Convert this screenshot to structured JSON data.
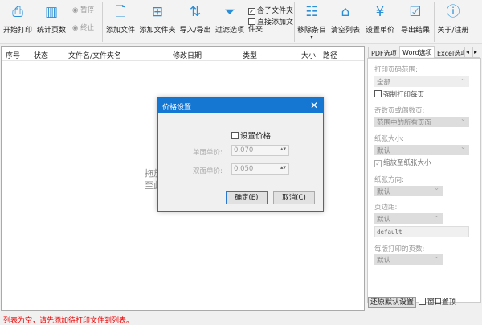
{
  "toolbar": {
    "start_print": "开始打印",
    "count_pages": "统计页数",
    "pause": "暂停",
    "stop": "终止",
    "add_file": "添加文件",
    "add_folder": "添加文件夹",
    "import_export": "导入/导出",
    "filter": "过滤选项",
    "include_subfolders": "含子文件夹",
    "direct_add_folder": "直接添加文件夹",
    "remove_items": "移除条目",
    "clear_list": "清空列表",
    "set_price": "设置单价",
    "export_results": "导出结果",
    "about": "关于/注册"
  },
  "list": {
    "columns": [
      "序号",
      "状态",
      "文件名/文件夹名",
      "修改日期",
      "类型",
      "大小",
      "路径"
    ],
    "drop_hint_1": "拖放",
    "drop_hint_2": "至此"
  },
  "panel": {
    "tabs": [
      "PDF选项",
      "Word选项",
      "Excel选项"
    ],
    "print_range_label": "打印页码范围:",
    "print_range": "全部",
    "force_print_each": "强制打印每页",
    "odd_even_label": "奇数页或偶数页:",
    "odd_even": "范围中的所有页面",
    "paper_size_label": "纸张大小:",
    "paper_size": "默认",
    "scale_to_paper": "缩放至纸张大小",
    "orientation_label": "纸张方向:",
    "orientation": "默认",
    "margin_label": "页边距:",
    "margin": "默认",
    "margin_value": "default",
    "pages_per_sheet_label": "每版打印的页数:",
    "pages_per_sheet": "默认",
    "restore_defaults": "还原默认设置",
    "window_on_top": "窗口置顶"
  },
  "status": "列表为空，请先添加待打印文件到列表。",
  "dialog": {
    "title": "价格设置",
    "set_price": "设置价格",
    "single_label": "单面单价:",
    "single_value": "0.070",
    "double_label": "双面单价:",
    "double_value": "0.050",
    "ok": "确定(E)",
    "cancel": "取消(C)"
  }
}
